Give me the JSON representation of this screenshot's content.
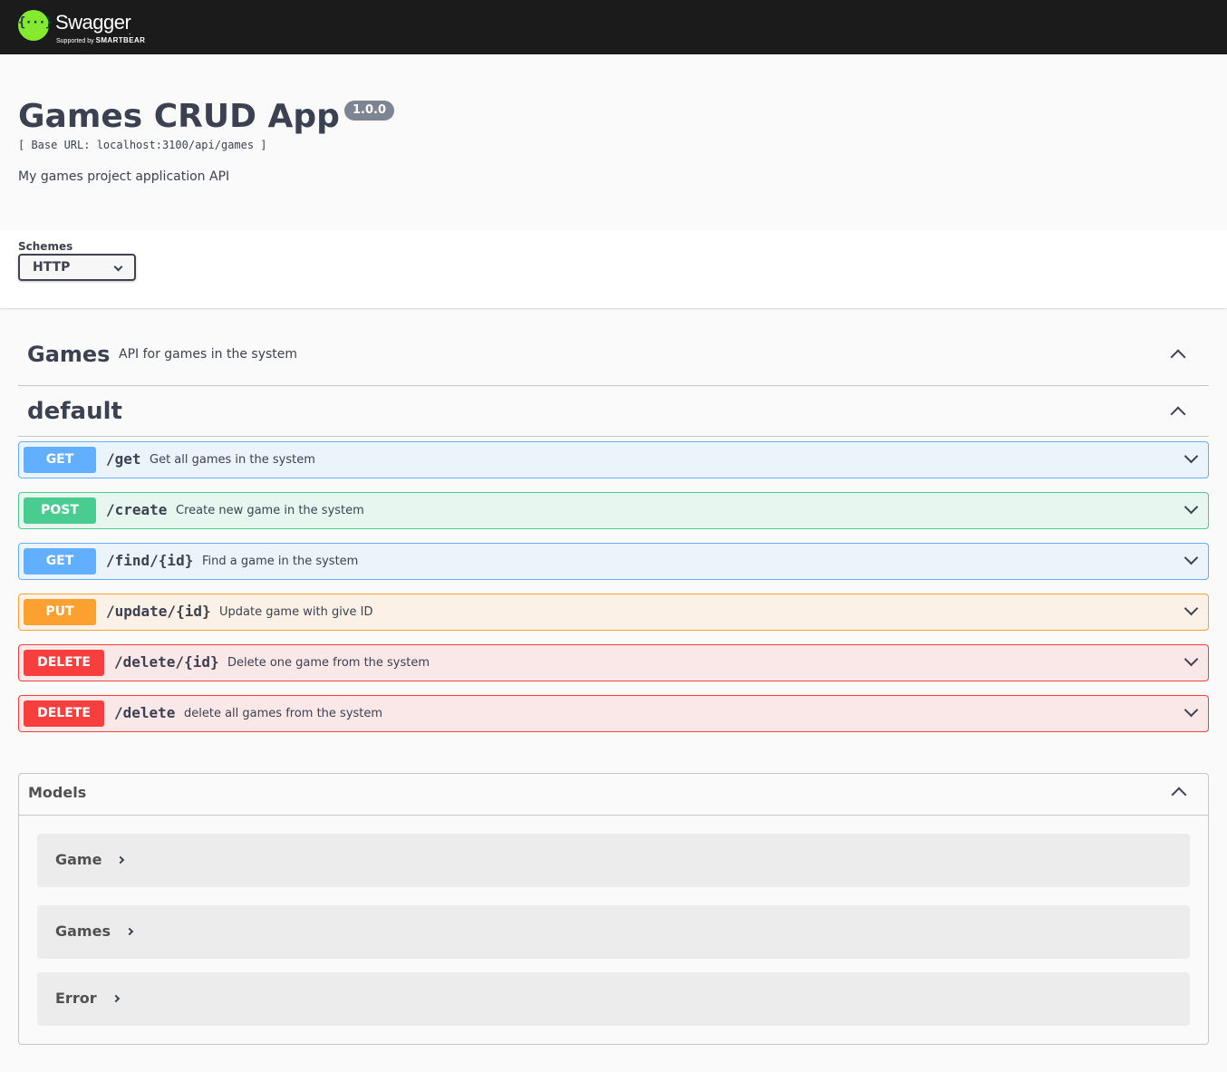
{
  "topbar": {
    "logo_glyph": "{···}",
    "brand": "Swagger",
    "brand_dot": ".",
    "supported_by": "Supported by",
    "company": "SMARTBEAR",
    "colors": {
      "bar": "#1b1b1b",
      "logo": "#85ea2d"
    }
  },
  "info": {
    "title": "Games CRUD App",
    "version": "1.0.0",
    "base_url": "[ Base URL: localhost:3100/api/games ]",
    "description": "My games project application API"
  },
  "schemes": {
    "label": "Schemes",
    "selected": "HTTP",
    "chevron_icon": "chevron-down-icon"
  },
  "tags": [
    {
      "name": "Games",
      "description": "API for games in the system",
      "icon": "chevron-up-icon"
    },
    {
      "name": "default",
      "description": "",
      "icon": "chevron-up-icon"
    }
  ],
  "operations": [
    {
      "method": "GET",
      "path": "/get",
      "summary": "Get all games in the system"
    },
    {
      "method": "POST",
      "path": "/create",
      "summary": "Create new game in the system"
    },
    {
      "method": "GET",
      "path": "/find/{id}",
      "summary": "Find a game in the system"
    },
    {
      "method": "PUT",
      "path": "/update/{id}",
      "summary": "Update game with give ID"
    },
    {
      "method": "DELETE",
      "path": "/delete/{id}",
      "summary": "Delete one game from the system"
    },
    {
      "method": "DELETE",
      "path": "/delete",
      "summary": "delete all games from the system"
    }
  ],
  "method_colors": {
    "GET": "#61affe",
    "POST": "#49cc90",
    "PUT": "#fca130",
    "DELETE": "#f93e3e"
  },
  "models": {
    "title": "Models",
    "items": [
      "Game",
      "Games",
      "Error"
    ]
  }
}
